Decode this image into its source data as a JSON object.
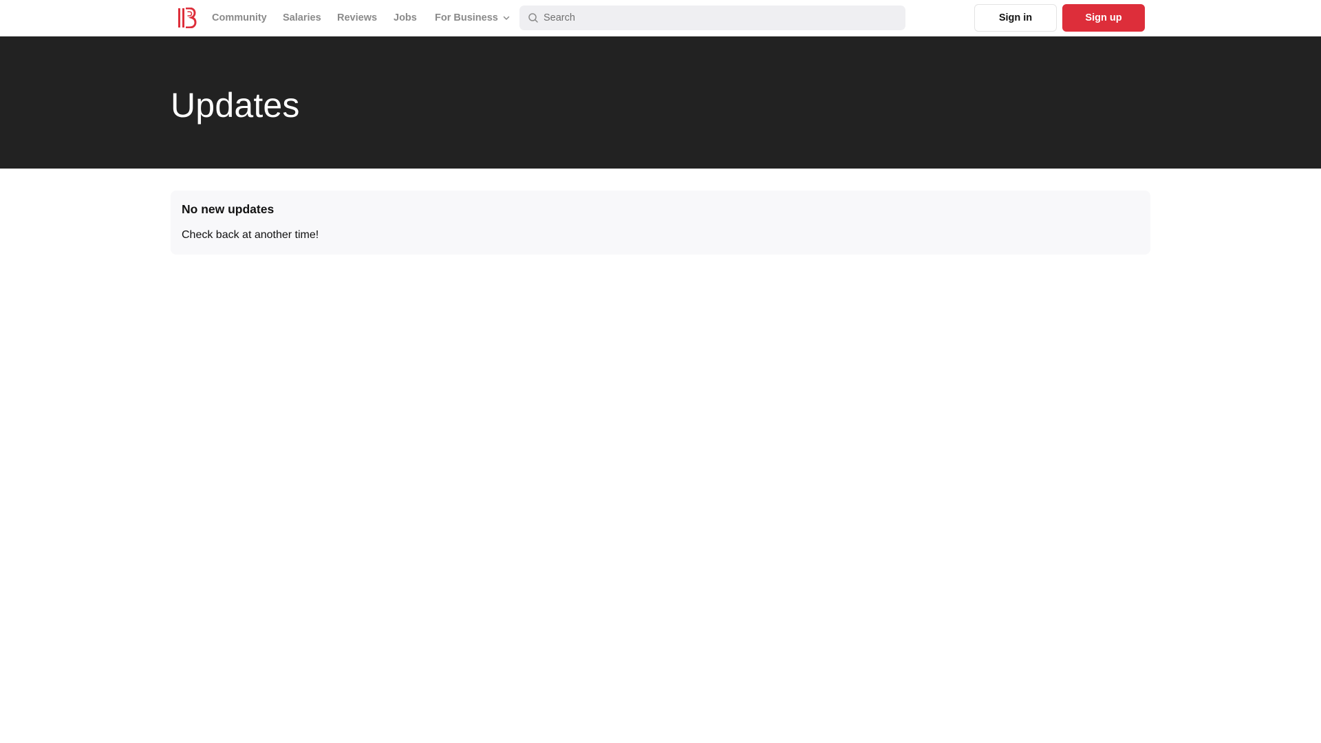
{
  "header": {
    "logo_icon": "brand-logo-icon",
    "brand_color": "#dd2e3a",
    "nav": [
      {
        "label": "Community"
      },
      {
        "label": "Salaries"
      },
      {
        "label": "Reviews"
      },
      {
        "label": "Jobs"
      },
      {
        "label": "For Business",
        "icon": "chevron-down-icon"
      }
    ],
    "search": {
      "placeholder": "Search",
      "value": "",
      "icon": "search-icon"
    },
    "signin_label": "Sign in",
    "signup_label": "Sign up"
  },
  "hero": {
    "title": "Updates",
    "background": "#222222"
  },
  "main": {
    "empty_state": {
      "title": "No new updates",
      "message": "Check back at another time!"
    }
  }
}
